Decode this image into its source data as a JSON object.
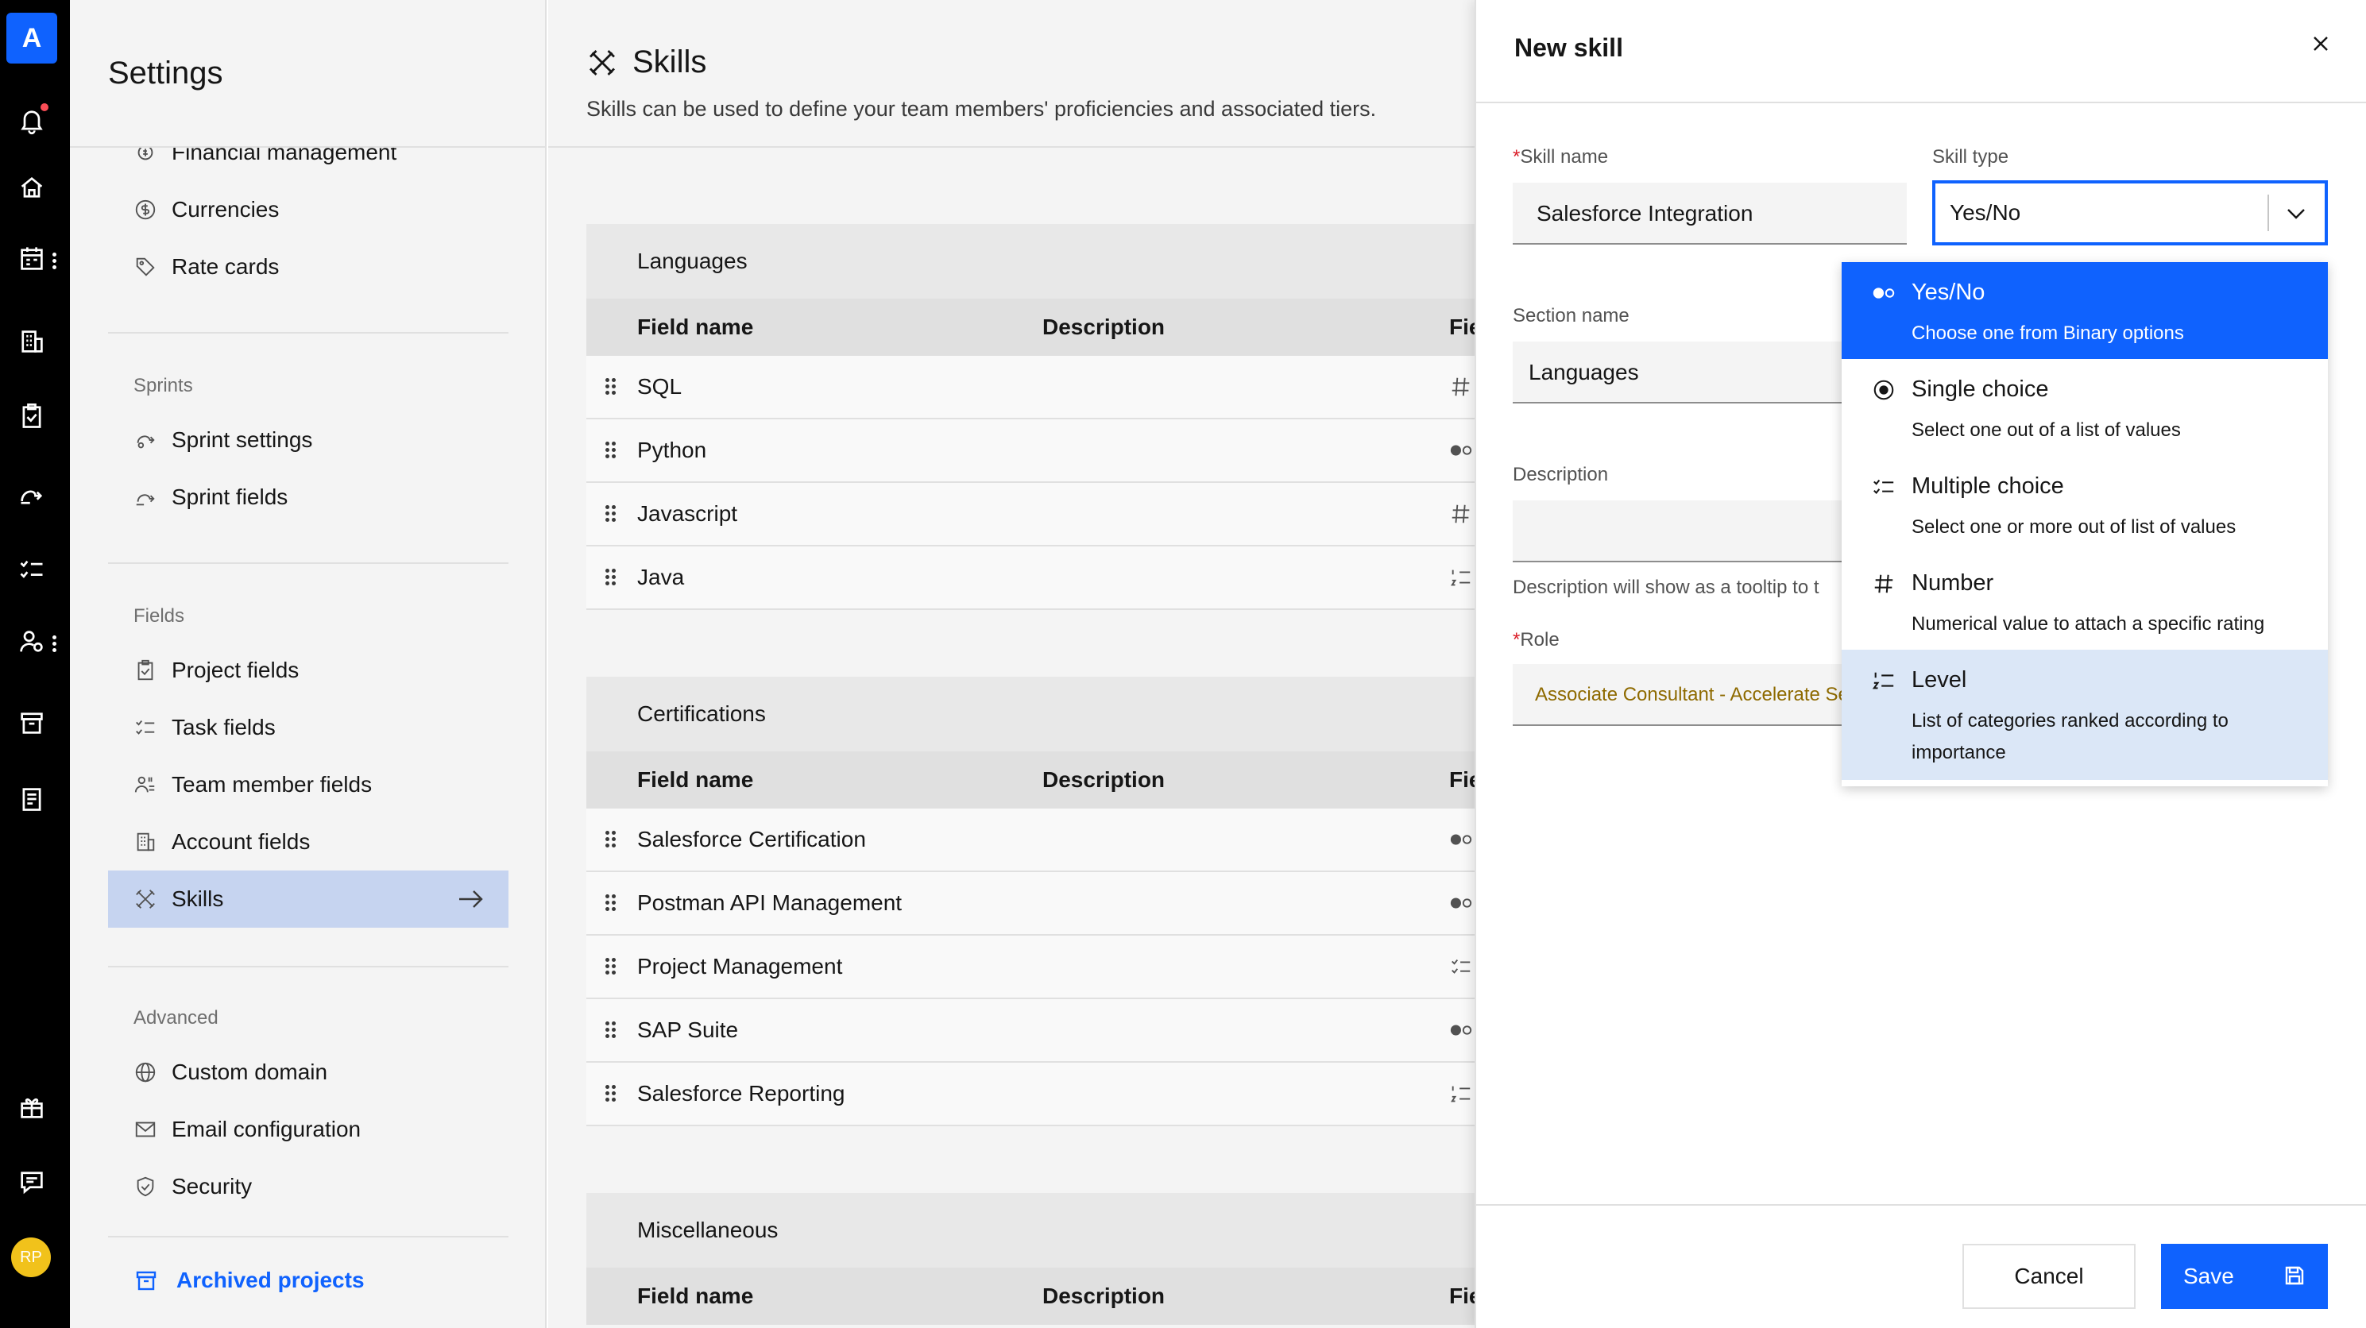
{
  "rail": {
    "logo": "A",
    "avatar": "RP",
    "icons": [
      "bell-icon",
      "home-icon",
      "calendar-icon",
      "building-icon",
      "clipboard-icon",
      "route-icon",
      "checklist-icon",
      "team-settings-icon",
      "archive-box-icon",
      "receipt-icon",
      "gift-icon",
      "chat-icon"
    ]
  },
  "sidebar": {
    "title": "Settings",
    "items_top": [
      {
        "label": "Financial management",
        "icon": "gear-money-icon"
      },
      {
        "label": "Currencies",
        "icon": "currency-icon"
      },
      {
        "label": "Rate cards",
        "icon": "tag-icon"
      }
    ],
    "sprints": {
      "heading": "Sprints",
      "items": [
        {
          "label": "Sprint settings",
          "icon": "sprint-settings-icon"
        },
        {
          "label": "Sprint fields",
          "icon": "sprint-fields-icon"
        }
      ]
    },
    "fields": {
      "heading": "Fields",
      "items": [
        {
          "label": "Project fields",
          "icon": "clipboard-icon"
        },
        {
          "label": "Task fields",
          "icon": "checklist-icon"
        },
        {
          "label": "Team member fields",
          "icon": "team-icon"
        },
        {
          "label": "Account fields",
          "icon": "building-icon"
        },
        {
          "label": "Skills",
          "icon": "skills-icon"
        }
      ]
    },
    "advanced": {
      "heading": "Advanced",
      "items": [
        {
          "label": "Custom domain",
          "icon": "globe-icon"
        },
        {
          "label": "Email configuration",
          "icon": "email-icon"
        },
        {
          "label": "Security",
          "icon": "shield-icon"
        }
      ]
    },
    "archived": "Archived projects"
  },
  "main": {
    "title": "Skills",
    "subtitle": "Skills can be used to define your team members' proficiencies and associated tiers.",
    "columns": {
      "name": "Field name",
      "description": "Description",
      "type": "Field type"
    },
    "groups": [
      {
        "title": "Languages",
        "rows": [
          {
            "name": "SQL",
            "type_icon": "number-icon"
          },
          {
            "name": "Python",
            "type_icon": "toggle-icon"
          },
          {
            "name": "Javascript",
            "type_icon": "number-icon"
          },
          {
            "name": "Java",
            "type_icon": "level-icon"
          }
        ]
      },
      {
        "title": "Certifications",
        "rows": [
          {
            "name": "Salesforce Certification",
            "type_icon": "toggle-icon"
          },
          {
            "name": "Postman API Management",
            "type_icon": "toggle-icon"
          },
          {
            "name": "Project Management",
            "type_icon": "checklist-icon"
          },
          {
            "name": "SAP Suite",
            "type_icon": "toggle-icon"
          },
          {
            "name": "Salesforce Reporting",
            "type_icon": "level-icon"
          }
        ]
      },
      {
        "title": "Miscellaneous",
        "rows": []
      }
    ]
  },
  "panel": {
    "title": "New skill",
    "skill_name": {
      "label": "Skill name",
      "value": "Salesforce Integration"
    },
    "skill_type": {
      "label": "Skill type",
      "value": "Yes/No"
    },
    "section_name": {
      "label": "Section name",
      "value": "Languages"
    },
    "description": {
      "label": "Description",
      "value": "",
      "hint": "Description will show as a tooltip to t"
    },
    "role": {
      "label": "Role",
      "value": "Associate Consultant - Accelerate Se"
    },
    "dropdown": [
      {
        "label": "Yes/No",
        "desc": "Choose one from Binary options",
        "icon": "toggle-icon",
        "state": "selected"
      },
      {
        "label": "Single choice",
        "desc": "Select one out of a list of values",
        "icon": "radio-icon",
        "state": "normal"
      },
      {
        "label": "Multiple choice",
        "desc": "Select one or more out of list of values",
        "icon": "checklist-icon",
        "state": "normal"
      },
      {
        "label": "Number",
        "desc": "Numerical value to attach a specific rating",
        "icon": "number-icon",
        "state": "normal"
      },
      {
        "label": "Level",
        "desc": "List of categories ranked according to importance",
        "icon": "level-icon",
        "state": "hover"
      }
    ],
    "cancel": "Cancel",
    "save": "Save"
  },
  "colors": {
    "primary": "#0f62fe",
    "rail": "#000000",
    "active_nav": "#c6d4f0",
    "hover_option": "#dbe7f7",
    "required": "#da1e28"
  }
}
